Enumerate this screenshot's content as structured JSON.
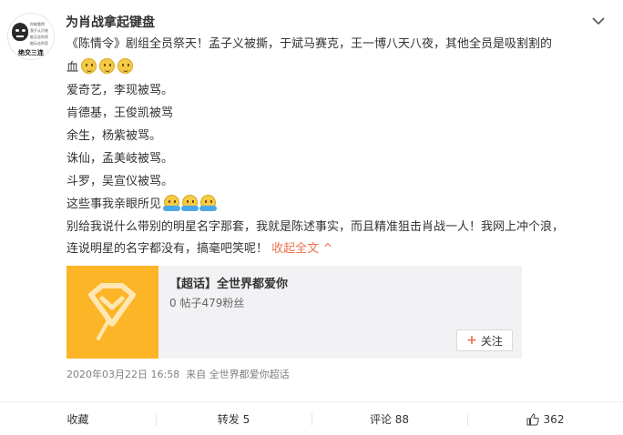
{
  "post": {
    "username": "为肖战拿起键盘",
    "avatar_text": {
      "lines": [
        "你能看得",
        "我不认识她",
        "能买去你家",
        "能玩去你家"
      ],
      "bottom": "绝交三连"
    },
    "lines": [
      {
        "text": "《陈情令》剧组全员祭天！孟子义被撕，于斌马赛克，王一博八天八夜，其他全员是吸割割的",
        "emojis": 0
      },
      {
        "text": "血",
        "emojis": 3,
        "emoji_type": "smile"
      },
      {
        "text": "爱奇艺，李现被骂。",
        "emojis": 0
      },
      {
        "text": "肯德基，王俊凯被骂",
        "emojis": 0
      },
      {
        "text": "余生，杨紫被骂。",
        "emojis": 0
      },
      {
        "text": "诛仙，孟美岐被骂。",
        "emojis": 0
      },
      {
        "text": "斗罗，吴宣仪被骂。",
        "emojis": 0
      },
      {
        "text": "这些事我亲眼所见",
        "emojis": 3,
        "emoji_type": "hands"
      },
      {
        "text": "别给我说什么带别的明星名字那套，我就是陈述事实，而且精准狙击肖战一人！我网上冲个浪，",
        "emojis": 0
      }
    ],
    "last_line": "连说明星的名字都没有，搞毫吧笑呢！",
    "collapse_label": "收起全文",
    "collapse_arrow": "^",
    "topic": {
      "title": "【超话】全世界都爱你",
      "meta": "0 帖子479粉丝",
      "follow_plus": "+",
      "follow_label": "关注",
      "accent": "#fcb526"
    },
    "timestamp": "2020年03月22日 16:58",
    "source": "来自 全世界都爱你超话"
  },
  "actions": {
    "favorite": "收藏",
    "repost": "转发 5",
    "comment": "评论 88",
    "like_count": "362"
  },
  "icons": {
    "more": "chevron-down-icon",
    "like": "thumbs-up-icon",
    "topic": "diamond-logo-icon"
  },
  "colors": {
    "link": "#eb7350",
    "text": "#333333",
    "muted": "#808080"
  }
}
